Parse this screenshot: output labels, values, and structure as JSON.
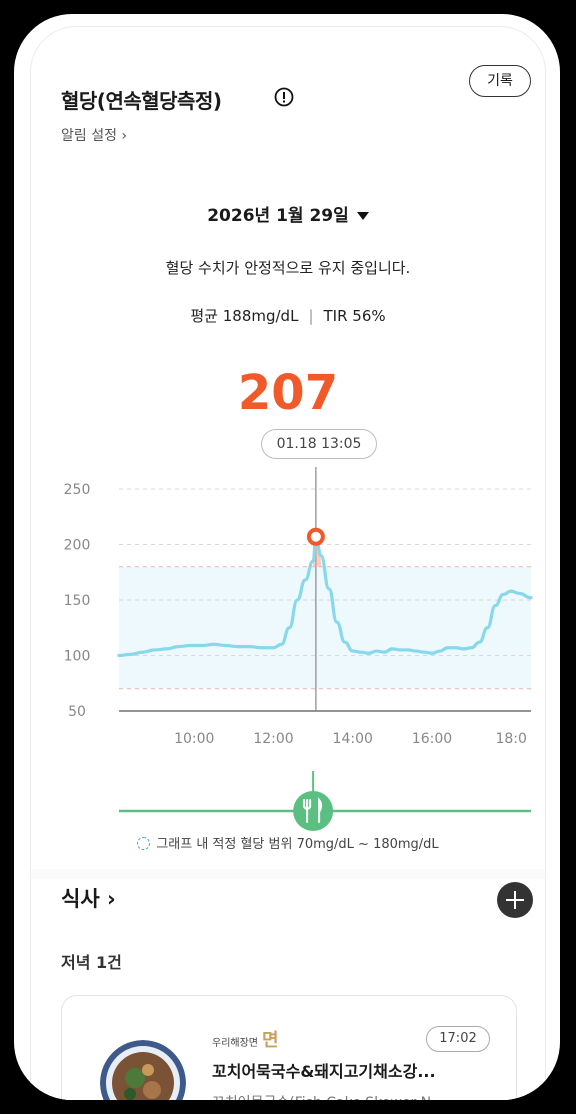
{
  "header": {
    "title": "혈당(연속혈당측정)",
    "record_label": "기록",
    "alarm_label": "알림 설정 ›"
  },
  "date_selector": {
    "label": "2026년 1월 29일"
  },
  "status_text": "혈당 수치가 안정적으로 유지 중입니다.",
  "stats": {
    "average": "평균 188mg/dL",
    "tir": "TIR 56%"
  },
  "selected": {
    "value": "207",
    "time": "01.18 13:05"
  },
  "colors": {
    "accent": "#f05a2a",
    "line": "#86d8ea",
    "range_fill": "#edf9fc",
    "meal_line": "#5cbf82"
  },
  "chart_data": {
    "type": "line",
    "title": "",
    "xlabel": "",
    "ylabel": "",
    "y_ticks": [
      "250",
      "200",
      "150",
      "100",
      "50"
    ],
    "x_ticks": [
      "10:00",
      "12:00",
      "14:00",
      "16:00",
      "18:0"
    ],
    "x_tick_values": [
      10,
      12,
      14,
      16,
      18
    ],
    "xlim": [
      8.1,
      18.5
    ],
    "ylim": [
      50,
      250
    ],
    "target_range": [
      70,
      180
    ],
    "series": [
      {
        "x": [
          8.1,
          8.4,
          8.7,
          9.0,
          9.3,
          9.6,
          9.9,
          10.2,
          10.5,
          10.8,
          11.1,
          11.4,
          11.7,
          12.0,
          12.2,
          12.4,
          12.6,
          12.8,
          13.0,
          13.07,
          13.2,
          13.4,
          13.6,
          13.8,
          14.0,
          14.2,
          14.4,
          14.6,
          14.8,
          15.0,
          15.2,
          15.4,
          15.6,
          15.8,
          16.0,
          16.2,
          16.4,
          16.6,
          16.8,
          17.0,
          17.2,
          17.4,
          17.6,
          17.8,
          18.0,
          18.2,
          18.5
        ],
        "y": [
          100,
          101,
          103,
          105,
          106,
          108,
          109,
          109,
          110,
          109,
          108,
          108,
          107,
          107,
          110,
          125,
          150,
          168,
          185,
          207,
          190,
          160,
          130,
          112,
          104,
          103,
          102,
          104,
          103,
          106,
          105,
          105,
          104,
          103,
          102,
          104,
          107,
          107,
          106,
          107,
          112,
          125,
          145,
          155,
          158,
          156,
          152
        ]
      }
    ],
    "selected_point": {
      "x": 13.07,
      "y": 207
    },
    "meal_marker": {
      "x": 13.0,
      "label": "fork-knife"
    }
  },
  "legend_text": "그래프 내 적정 혈당 범위 70mg/dL ~ 180mg/dL",
  "meals": {
    "title": "식사 ›",
    "group_label": "저녁 1건",
    "card": {
      "brand": "우리해장면",
      "brand_mark": "면",
      "time": "17:02",
      "name": "꼬치어묵국수&돼지고기채소강...",
      "subtitle": "꼬치어묵국수(Fish Cake Skewer N..."
    }
  }
}
